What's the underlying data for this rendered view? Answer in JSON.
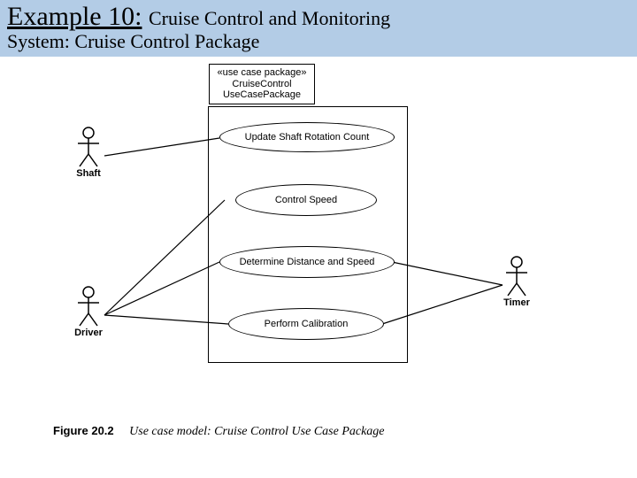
{
  "header": {
    "title_prefix": "Example 10:",
    "title_suffix": "Cruise Control and Monitoring",
    "subtitle": "System: Cruise Control Package"
  },
  "package": {
    "stereotype": "«use case package»",
    "name_line1": "CruiseControl",
    "name_line2": "UseCasePackage"
  },
  "usecases": {
    "uc1": "Update Shaft Rotation Count",
    "uc2": "Control Speed",
    "uc3": "Determine Distance and Speed",
    "uc4": "Perform Calibration"
  },
  "actors": {
    "shaft": "Shaft",
    "driver": "Driver",
    "timer": "Timer"
  },
  "figure": {
    "number": "Figure 20.2",
    "caption": "Use case model: Cruise Control Use Case Package"
  }
}
